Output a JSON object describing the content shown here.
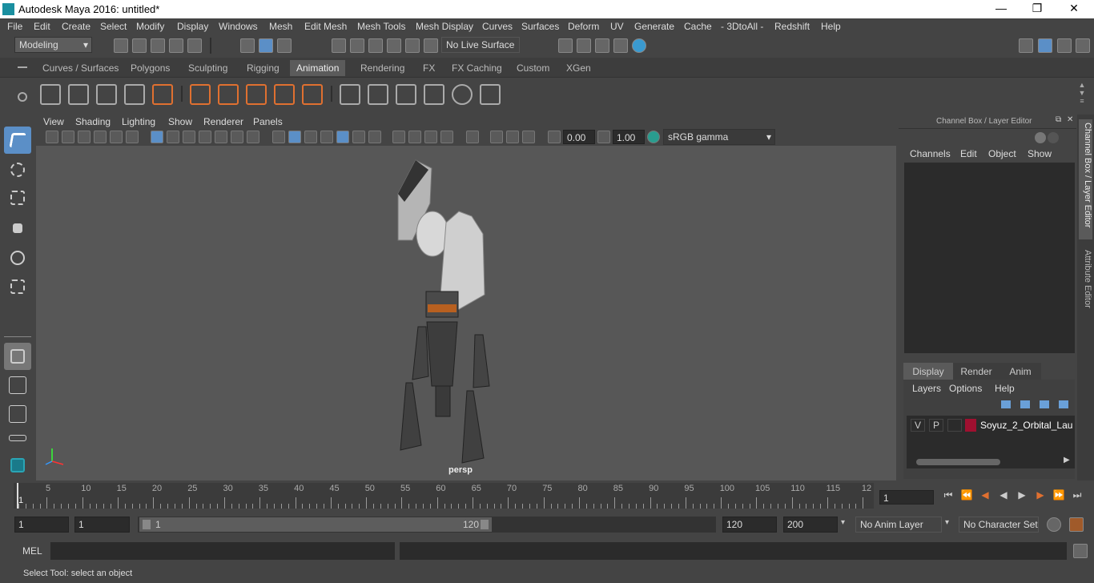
{
  "window": {
    "title": "Autodesk Maya 2016: untitled*"
  },
  "menus": [
    "File",
    "Edit",
    "Create",
    "Select",
    "Modify",
    "Display",
    "Windows",
    "Mesh",
    "Edit Mesh",
    "Mesh Tools",
    "Mesh Display",
    "Curves",
    "Surfaces",
    "Deform",
    "UV",
    "Generate",
    "Cache",
    "- 3DtoAll -",
    "Redshift",
    "Help"
  ],
  "statusline": {
    "mode": "Modeling",
    "live_surface": "No Live Surface"
  },
  "shelf_tabs": [
    "Curves / Surfaces",
    "Polygons",
    "Sculpting",
    "Rigging",
    "Animation",
    "Rendering",
    "FX",
    "FX Caching",
    "Custom",
    "XGen"
  ],
  "active_shelf_tab": "Animation",
  "panel_menus": [
    "View",
    "Shading",
    "Lighting",
    "Show",
    "Renderer",
    "Panels"
  ],
  "panel_toolbar": {
    "exposure": "0.00",
    "gamma": "1.00",
    "color_space": "sRGB gamma"
  },
  "viewport": {
    "camera_label": "persp"
  },
  "channel_box": {
    "title": "Channel Box / Layer Editor",
    "menus": [
      "Channels",
      "Edit",
      "Object",
      "Show"
    ]
  },
  "layer_editor": {
    "tabs": [
      "Display",
      "Render",
      "Anim"
    ],
    "active_tab": "Display",
    "menus": [
      "Layers",
      "Options",
      "Help"
    ],
    "layers": [
      {
        "v": "V",
        "p": "P",
        "name": "Soyuz_2_Orbital_Laun",
        "color": "#a01030"
      }
    ]
  },
  "side_tabs": [
    "Channel Box / Layer Editor",
    "Attribute Editor"
  ],
  "timeline": {
    "labels": [
      "5",
      "10",
      "15",
      "20",
      "25",
      "30",
      "35",
      "40",
      "45",
      "50",
      "55",
      "60",
      "65",
      "70",
      "75",
      "80",
      "85",
      "90",
      "95",
      "100",
      "105",
      "110",
      "115",
      "12"
    ],
    "start_marker": "1",
    "current_frame": "1"
  },
  "range": {
    "start": "1",
    "anim_start": "1",
    "slider_min": "1",
    "slider_max": "120",
    "end": "120",
    "anim_end": "200",
    "anim_layer": "No Anim Layer",
    "character_set": "No Character Set"
  },
  "cmdline": {
    "label": "MEL"
  },
  "help_line": "Select Tool: select an object",
  "colors": {
    "accent": "#5b8fc7",
    "bg": "#444444",
    "viewport": "#575757",
    "layer_color": "#a01030"
  }
}
